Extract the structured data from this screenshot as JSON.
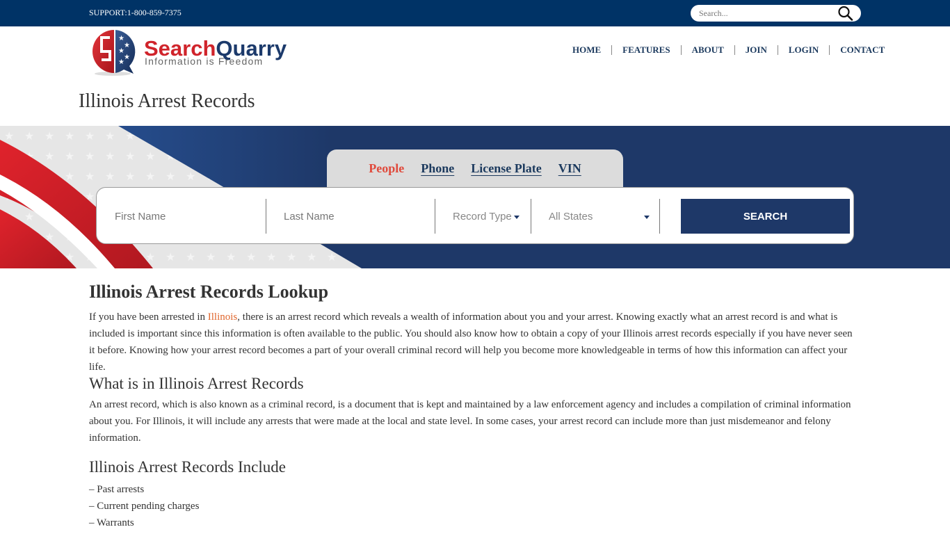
{
  "topbar": {
    "support_text": "SUPPORT:1-800-859-7375",
    "search_placeholder": "Search...",
    "search_icon": "magnifier-icon",
    "background_color": "#003366"
  },
  "logo": {
    "brand_part1": "Search",
    "brand_part2": "Quarry",
    "tagline": "Information is Freedom",
    "colors": {
      "red": "#d0242b",
      "blue": "#1c3a6b",
      "gray": "#666666"
    }
  },
  "nav": {
    "items": [
      {
        "label": "HOME"
      },
      {
        "label": "FEATURES"
      },
      {
        "label": "ABOUT"
      },
      {
        "label": "JOIN"
      },
      {
        "label": "LOGIN"
      },
      {
        "label": "CONTACT"
      }
    ]
  },
  "page_title": "Illinois Arrest Records",
  "search_widget": {
    "tabs": [
      {
        "label": "People",
        "active": true
      },
      {
        "label": "Phone",
        "active": false
      },
      {
        "label": "License Plate",
        "active": false
      },
      {
        "label": "VIN",
        "active": false
      }
    ],
    "first_name_placeholder": "First Name",
    "last_name_placeholder": "Last Name",
    "record_type_label": "Record Type",
    "state_label": "All States",
    "search_button_label": "SEARCH",
    "colors": {
      "active_tab": "#e04a3c",
      "primary": "#1e3868"
    }
  },
  "article": {
    "heading": "Illinois Arrest Records Lookup",
    "intro_before_link": "If you have been arrested in ",
    "intro_link": "Illinois",
    "intro_after_link": ", there is an arrest record which reveals a wealth of information about you and your arrest. Knowing exactly what an arrest record is and what is included is important since this information is often available to the public. You should also know how to obtain a copy of your Illinois arrest records especially if you have never seen it before. Knowing how your arrest record becomes a part of your overall criminal record will help you become more knowledgeable in terms of how this information can affect your life.",
    "section1_heading": "What is in Illinois Arrest Records",
    "section1_text": "An arrest record, which is also known as a criminal record, is a document that is kept and maintained by a law enforcement agency and includes a compilation of criminal information about you. For Illinois, it will include any arrests that were made at the local and state level. In some cases, your arrest record can include more than just misdemeanor and felony information.",
    "section2_heading": "Illinois Arrest Records Include",
    "list_items": [
      "– Past arrests",
      "– Current pending charges",
      "– Warrants"
    ]
  }
}
